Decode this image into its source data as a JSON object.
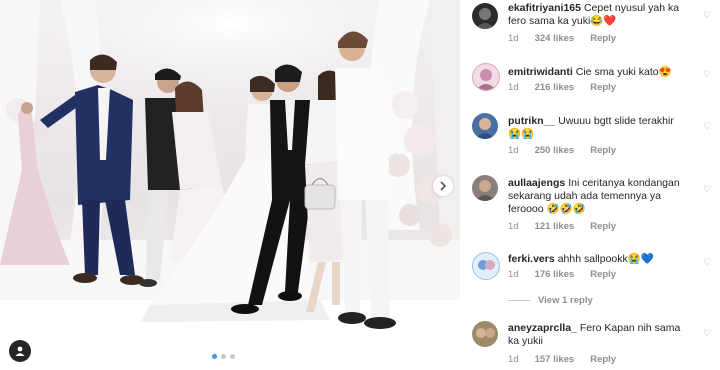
{
  "post": {
    "carousel": {
      "dot_count": 3,
      "active_index": 0
    },
    "user_tag_icon": "user-tag-icon",
    "next_icon": "chevron-right-icon"
  },
  "comments": [
    {
      "username": "ekafitriyani165",
      "text": "Cepet nyusul yah ka fero sama ka yuki😂❤️",
      "age": "1d",
      "likes": "324 likes",
      "reply": "Reply",
      "avatar_color": "#2b2b2b"
    },
    {
      "username": "emitriwidanti",
      "text": "Cie sma yuki kato😍",
      "age": "1d",
      "likes": "216 likes",
      "reply": "Reply",
      "avatar_color": "#c98fae"
    },
    {
      "username": "putrikn__",
      "text": "Uwuuu bgtt slide terakhir😭😭",
      "age": "1d",
      "likes": "250 likes",
      "reply": "Reply",
      "avatar_color": "#4a6fa5"
    },
    {
      "username": "aullaajengs",
      "text": "Ini ceritanya kondangan sekarang udah ada temennya ya feroooo 🤣🤣🤣",
      "age": "1d",
      "likes": "121 likes",
      "reply": "Reply",
      "avatar_color": "#8a7f7a"
    },
    {
      "username": "ferki.vers",
      "text": "ahhh sallpookk😭💙",
      "age": "1d",
      "likes": "176 likes",
      "reply": "Reply",
      "avatar_color": "#6f9fd8"
    },
    {
      "username": "aneyzaprclla_",
      "text": "Fero Kapan nih sama ka yukii",
      "age": "1d",
      "likes": "157 likes",
      "reply": "Reply",
      "avatar_color": "#9c8a6a"
    }
  ],
  "view_replies": "View 1 reply",
  "heart_icon": "heart-outline-icon",
  "colors": {
    "meta": "#8e8e8e",
    "text": "#262626",
    "active_dot": "#3897f0"
  }
}
